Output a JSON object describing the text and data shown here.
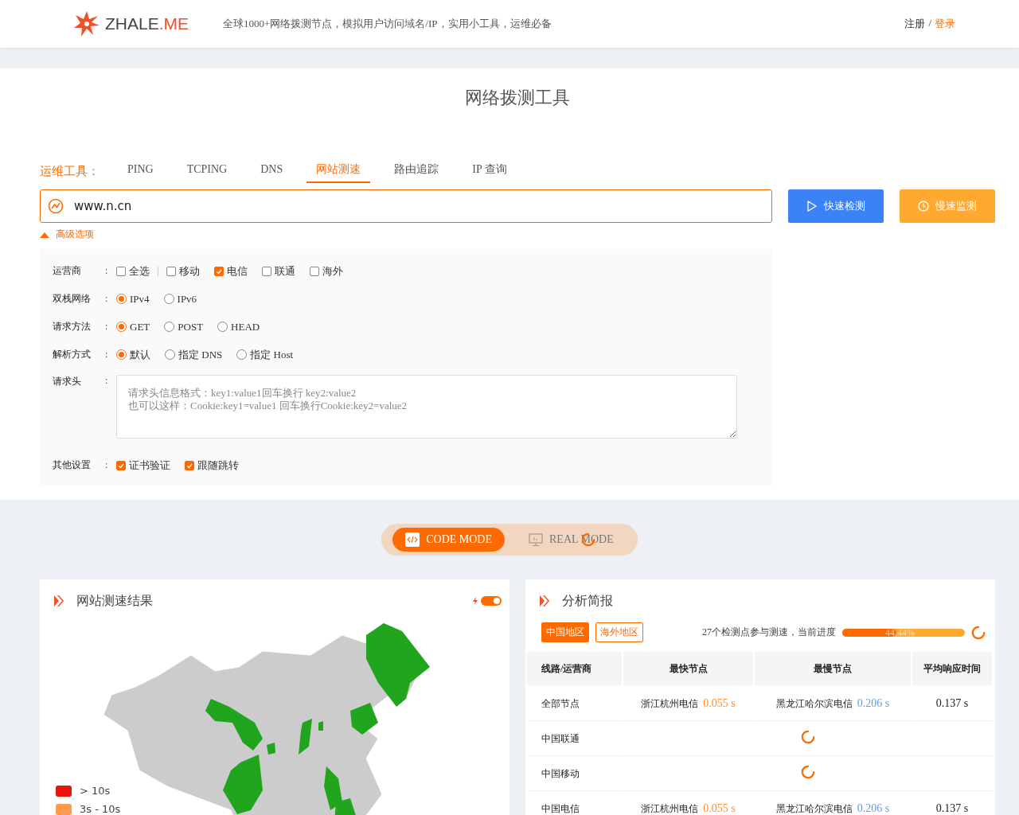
{
  "header": {
    "logo_main": "ZHALE",
    "logo_accent": ".ME",
    "tagline": "全球1000+网络拨测节点，模拟用户访问域名/IP，实用小工具，运维必备",
    "register": "注册",
    "separator": "/",
    "login": "登录"
  },
  "title": "网络拨测工具",
  "tools": {
    "label": "运维工具：",
    "tabs": [
      {
        "label": "PING",
        "selected": false
      },
      {
        "label": "TCPING",
        "selected": false
      },
      {
        "label": "DNS",
        "selected": false
      },
      {
        "label": "网站测速",
        "selected": true
      },
      {
        "label": "路由追踪",
        "selected": false
      },
      {
        "label": "IP 查询",
        "selected": false
      }
    ]
  },
  "url_field": {
    "value": "www.n.cn"
  },
  "buttons": [
    {
      "label": "快速检测",
      "kind": "primary"
    },
    {
      "label": "慢速监测",
      "kind": "secondary"
    }
  ],
  "advanced": {
    "label": "高级选项",
    "expanded": true
  },
  "options": [
    {
      "label": "运营商",
      "colon": ":",
      "kind": "checkbox",
      "items": [
        {
          "label": "全选",
          "checked": false
        },
        {
          "label": "移动",
          "checked": false
        },
        {
          "label": "电信",
          "checked": true
        },
        {
          "label": "联通",
          "checked": false
        },
        {
          "label": "海外",
          "checked": false
        }
      ]
    },
    {
      "label": "双栈网络",
      "colon": ":",
      "kind": "radio",
      "items": [
        {
          "label": "IPv4",
          "checked": true
        },
        {
          "label": "IPv6",
          "checked": false
        }
      ]
    },
    {
      "label": "请求方法",
      "colon": ":",
      "kind": "radio",
      "items": [
        {
          "label": "GET",
          "checked": true
        },
        {
          "label": "POST",
          "checked": false
        },
        {
          "label": "HEAD",
          "checked": false
        }
      ]
    },
    {
      "label": "解析方式",
      "colon": ":",
      "kind": "radio",
      "items": [
        {
          "label": "默认",
          "checked": true
        },
        {
          "label": "指定 DNS",
          "checked": false
        },
        {
          "label": "指定 Host",
          "checked": false
        }
      ]
    },
    {
      "label": "请求头",
      "colon": ":",
      "kind": "textarea",
      "placeholder": "请求头信息格式：key1:value1回车换行 key2:value2\n也可以这样：Cookie:key1=value1 回车换行Cookie:key2=value2"
    },
    {
      "label": "其他设置",
      "colon": ":",
      "kind": "checkbox",
      "items": [
        {
          "label": "证书验证",
          "checked": true
        },
        {
          "label": "跟随跳转",
          "checked": true
        }
      ]
    }
  ],
  "modes": [
    {
      "label": "CODE MODE",
      "selected": true,
      "loading": false
    },
    {
      "label": "REAL MODE",
      "selected": false,
      "loading": true
    }
  ],
  "map_card": {
    "title": "网站测速结果",
    "auto_refresh": true,
    "legend": [
      {
        "label": "> 10s",
        "color": "#e8150f"
      },
      {
        "label": "3s - 10s",
        "color": "#ff9a4d"
      }
    ]
  },
  "report_card": {
    "title": "分析简报",
    "regions": [
      {
        "label": "中国地区",
        "selected": true
      },
      {
        "label": "海外地区",
        "selected": false
      }
    ],
    "progress_text": "27个检测点参与测速，当前进度",
    "progress": {
      "level": 0.4444,
      "label": "44.44%"
    },
    "columns": [
      "线路/运营商",
      "最快节点",
      "最慢节点",
      "平均响应时间"
    ],
    "rows": [
      {
        "name": "全部节点",
        "loading": false,
        "fastest_node": "浙江杭州电信",
        "fastest_time": "0.055 s",
        "slowest_node": "黑龙江哈尔滨电信",
        "slowest_time": "0.206 s",
        "average": "0.137 s"
      },
      {
        "name": "中国联通",
        "loading": true
      },
      {
        "name": "中国移动",
        "loading": true
      },
      {
        "name": "中国电信",
        "loading": false,
        "fastest_node": "浙江杭州电信",
        "fastest_time": "0.055 s",
        "slowest_node": "黑龙江哈尔滨电信",
        "slowest_time": "0.206 s",
        "average": "0.137 s"
      }
    ]
  }
}
